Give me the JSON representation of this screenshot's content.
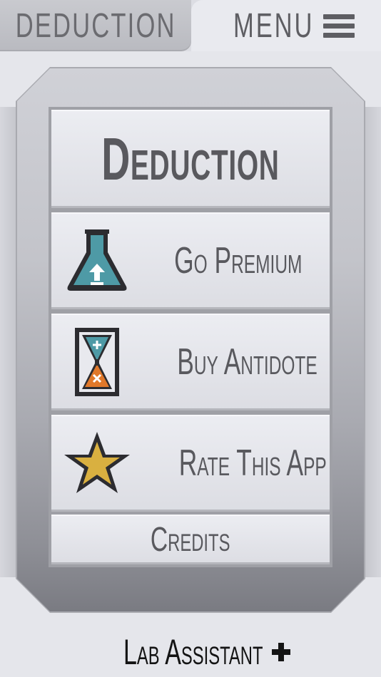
{
  "header": {
    "left_tab_label": "DEDUCTION",
    "right_tab_label": "MENU"
  },
  "menu": {
    "title": "Deduction",
    "items": [
      {
        "label": "Go Premium",
        "icon": "flask-upload-icon",
        "color": "#4e9aa6"
      },
      {
        "label": "Buy Antidote",
        "icon": "hourglass-icon",
        "color": "#e0782a"
      },
      {
        "label": "Rate This App",
        "icon": "star-icon",
        "color": "#d9b040"
      }
    ],
    "credits_label": "Credits"
  },
  "footer": {
    "label": "Lab Assistant"
  },
  "colors": {
    "text": "#59595e",
    "background": "#dcdde3",
    "footer_text": "#141414"
  }
}
